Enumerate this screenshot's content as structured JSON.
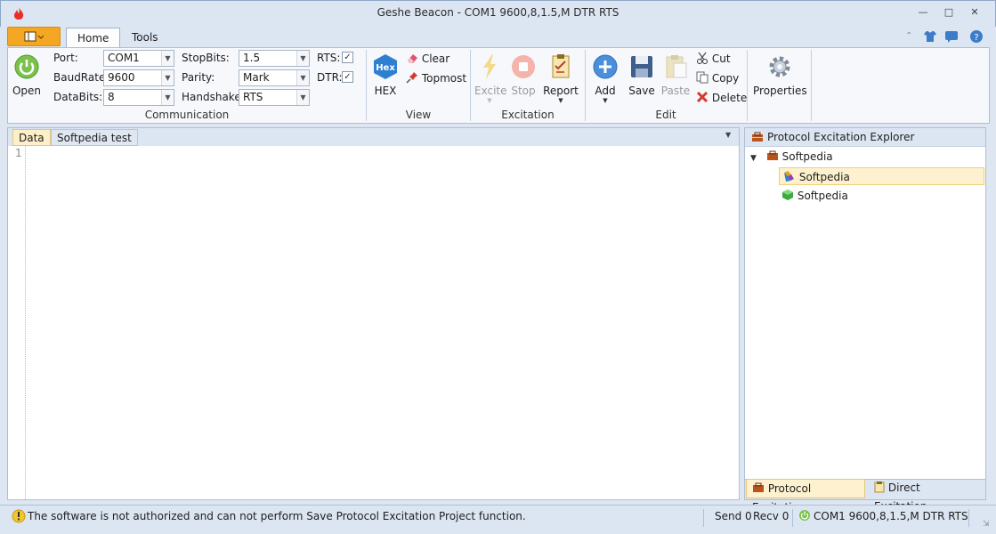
{
  "window": {
    "title": "Geshe Beacon - COM1  9600,8,1.5,M  DTR  RTS",
    "app_icon": "flame-icon",
    "controls": [
      "minimize",
      "maximize",
      "close"
    ]
  },
  "ribbon_tabs": [
    "Home",
    "Tools"
  ],
  "right_icons": [
    "collapse-ribbon-icon",
    "skin-icon",
    "feedback-icon",
    "help-icon"
  ],
  "communication": {
    "open_label": "Open",
    "port_label": "Port:",
    "port_value": "COM1",
    "baud_label": "BaudRate:",
    "baud_value": "9600",
    "databits_label": "DataBits:",
    "databits_value": "8",
    "stopbits_label": "StopBits:",
    "stopbits_value": "1.5",
    "parity_label": "Parity:",
    "parity_value": "Mark",
    "handshake_label": "Handshake:",
    "handshake_value": "RTS",
    "rts_label": "RTS:",
    "rts_checked": true,
    "dtr_label": "DTR:",
    "dtr_checked": true,
    "group_label": "Communication"
  },
  "view": {
    "hex_label": "HEX",
    "hex_badge": "Hex",
    "clear_label": "Clear",
    "topmost_label": "Topmost",
    "group_label": "View"
  },
  "excitation": {
    "excite_label": "Excite",
    "stop_label": "Stop",
    "report_label": "Report",
    "group_label": "Excitation"
  },
  "edit": {
    "add_label": "Add",
    "save_label": "Save",
    "paste_label": "Paste",
    "cut_label": "Cut",
    "copy_label": "Copy",
    "delete_label": "Delete",
    "group_label": "Edit"
  },
  "properties_label": "Properties",
  "doc_tabs": [
    "Data",
    "Softpedia test"
  ],
  "editor": {
    "line_numbers": [
      "1"
    ]
  },
  "explorer": {
    "title": "Protocol Excitation Explorer",
    "root": "Softpedia",
    "children": [
      "Softpedia",
      "Softpedia"
    ],
    "bottom_tabs": [
      "Protocol Excitatio...",
      "Direct Excitation..."
    ]
  },
  "status": {
    "message": "The software is not authorized and can not perform Save Protocol Excitation Project function.",
    "send": "Send 0",
    "recv": "Recv 0",
    "connection": "COM1  9600,8,1.5,M  DTR  RTS"
  },
  "colors": {
    "accent": "#f5a623",
    "ribbon_bg": "#dce6f2",
    "selected_row": "#fdf1cf"
  }
}
